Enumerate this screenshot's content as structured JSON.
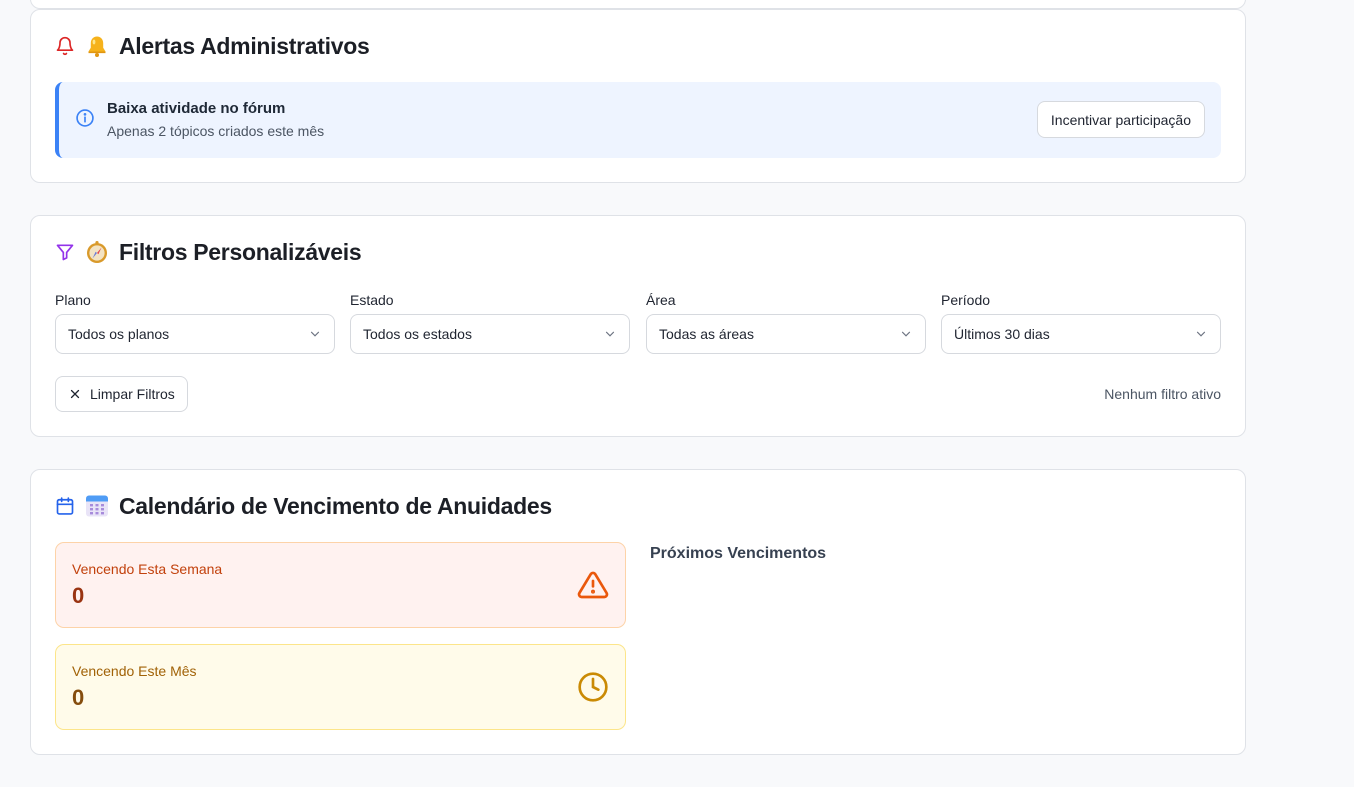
{
  "alerts": {
    "title": "Alertas Administrativos",
    "title_icon": "bell-icon",
    "title_emoji": "bell-emoji",
    "items": [
      {
        "icon": "info-icon",
        "title": "Baixa atividade no fórum",
        "description": "Apenas 2 tópicos criados este mês",
        "action_label": "Incentivar participação"
      }
    ]
  },
  "filters": {
    "title": "Filtros Personalizáveis",
    "title_icon": "filter-icon",
    "title_emoji": "compass-emoji",
    "fields": [
      {
        "label": "Plano",
        "value": "Todos os planos"
      },
      {
        "label": "Estado",
        "value": "Todos os estados"
      },
      {
        "label": "Área",
        "value": "Todas as áreas"
      },
      {
        "label": "Período",
        "value": "Últimos 30 dias"
      }
    ],
    "clear_label": "Limpar Filtros",
    "status": "Nenhum filtro ativo"
  },
  "calendar": {
    "title": "Calendário de Vencimento de Anuidades",
    "title_icon": "calendar-icon",
    "title_emoji": "calendar-emoji",
    "week": {
      "label": "Vencendo Esta Semana",
      "value": "0",
      "icon": "warning-triangle-icon"
    },
    "month": {
      "label": "Vencendo Este Mês",
      "value": "0",
      "icon": "clock-icon"
    },
    "upcoming_title": "Próximos Vencimentos"
  },
  "colors": {
    "bell_red": "#dc2626",
    "filter_purple": "#9333ea",
    "calendar_blue": "#2563eb",
    "info_blue": "#3b82f6",
    "warning_orange": "#ea580c",
    "clock_amber": "#ca8a04"
  }
}
